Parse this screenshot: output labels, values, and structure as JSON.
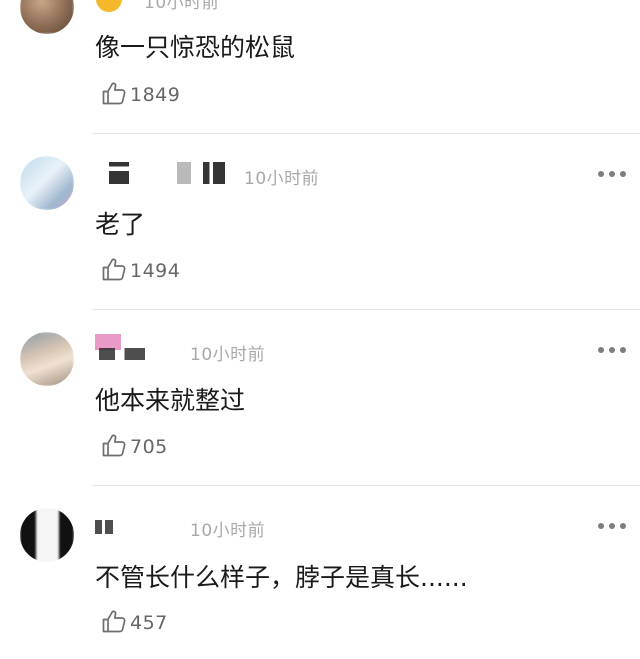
{
  "comments": [
    {
      "username": "",
      "time": "10小时前",
      "text": "像一只惊恐的松鼠",
      "likes": "1849"
    },
    {
      "username": "",
      "time": "10小时前",
      "text": "老了",
      "likes": "1494"
    },
    {
      "username": "",
      "time": "10小时前",
      "text": "他本来就整过",
      "likes": "705"
    },
    {
      "username": "",
      "time": "10小时前",
      "text": "不管长什么样子，脖子是真长......",
      "likes": "457"
    }
  ],
  "icons": {
    "like": "thumbs-up-icon",
    "more": "more-dots-icon"
  },
  "colors": {
    "text": "#1a1a1a",
    "muted": "#a8a8a8",
    "like_count": "#666666",
    "divider": "#e3e3e3"
  }
}
